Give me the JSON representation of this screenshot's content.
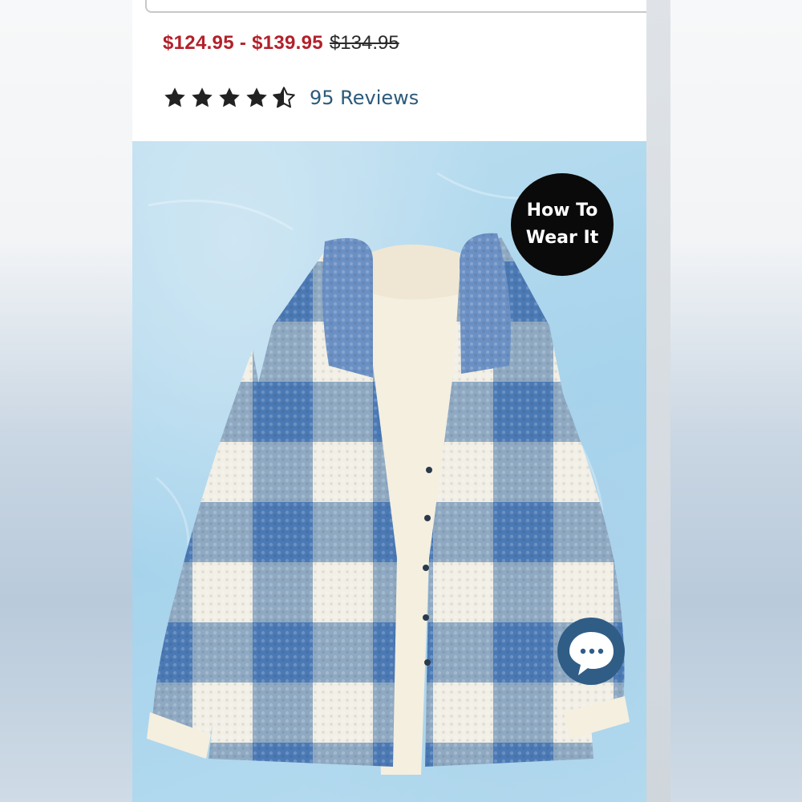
{
  "price": {
    "range": "$124.95 - $139.95",
    "original": "$134.95"
  },
  "rating": {
    "stars": 4.5,
    "max_stars": 5,
    "reviews_label": "95 Reviews"
  },
  "badge": {
    "line1": "How To",
    "line2": "Wear It"
  },
  "icons": {
    "search": "search-icon",
    "star": "star-icon",
    "chat": "chat-bubble-icon"
  },
  "colors": {
    "sale_price": "#b3202a",
    "link": "#2c5a7a",
    "badge_bg": "#0a0a0a",
    "chat_bg": "#2f5d86"
  }
}
